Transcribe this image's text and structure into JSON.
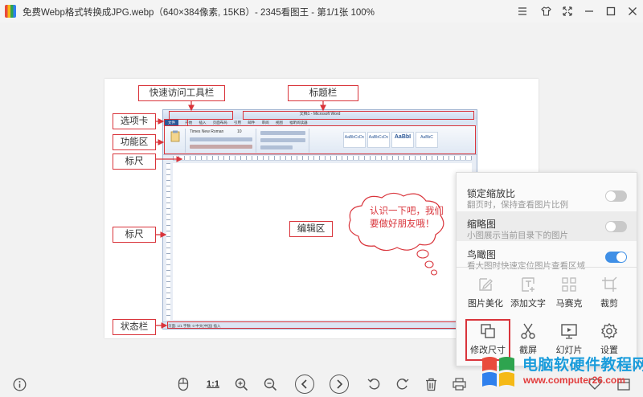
{
  "window": {
    "title": "免费Webp格式转换成JPG.webp（640×384像素, 15KB）- 2345看图王 - 第1/1张 100%"
  },
  "image": {
    "callouts": {
      "quick_access": "快速访问工具栏",
      "title_bar": "标题栏",
      "tab": "选项卡",
      "ribbon": "功能区",
      "ruler_top": "标尺",
      "ruler_left": "标尺",
      "edit_area": "编辑区",
      "status_bar": "状态栏"
    },
    "bubble_text_1": "认识一下吧，我们",
    "bubble_text_2": "要做好朋友哦！",
    "word_title": "文档1 - Microsoft Word",
    "word_tabs": [
      "文件",
      "开始",
      "插入",
      "页面布局",
      "引用",
      "邮件",
      "审阅",
      "视图",
      "福昕阅读器"
    ],
    "word_font": "Times New Roman",
    "word_font_size": "10",
    "word_styles": [
      "AaBbCcDc",
      "AaBbCcDc",
      "AaBbI",
      "AaBbC"
    ],
    "word_status": "页面: 1/1   字数: 0   中文(中国)   插入"
  },
  "panel": {
    "rows": [
      {
        "title": "锁定缩放比",
        "desc": "翻页时，保持查看图片比例",
        "on": false
      },
      {
        "title": "缩略图",
        "desc": "小图展示当前目录下的图片",
        "on": false
      },
      {
        "title": "鸟瞰图",
        "desc": "看大图时快速定位图片查看区域",
        "on": true
      }
    ],
    "tools": [
      {
        "label": "图片美化",
        "icon": "edit-icon"
      },
      {
        "label": "添加文字",
        "icon": "add-text-icon"
      },
      {
        "label": "马赛克",
        "icon": "mosaic-icon"
      },
      {
        "label": "裁剪",
        "icon": "crop-icon"
      },
      {
        "label": "修改尺寸",
        "icon": "resize-icon"
      },
      {
        "label": "截屏",
        "icon": "scissors-icon"
      },
      {
        "label": "幻灯片",
        "icon": "slideshow-icon"
      },
      {
        "label": "设置",
        "icon": "gear-icon"
      }
    ]
  },
  "toolbar": {
    "one_to_one": "1:1"
  },
  "watermark": {
    "text": "电脑软硬件教程网",
    "url": "www.computer26.com"
  },
  "colors": {
    "accent_red": "#d9343b",
    "toggle_on": "#3f8fe6",
    "watermark_blue": "#1a9cdb",
    "watermark_red": "#e23c3c"
  }
}
